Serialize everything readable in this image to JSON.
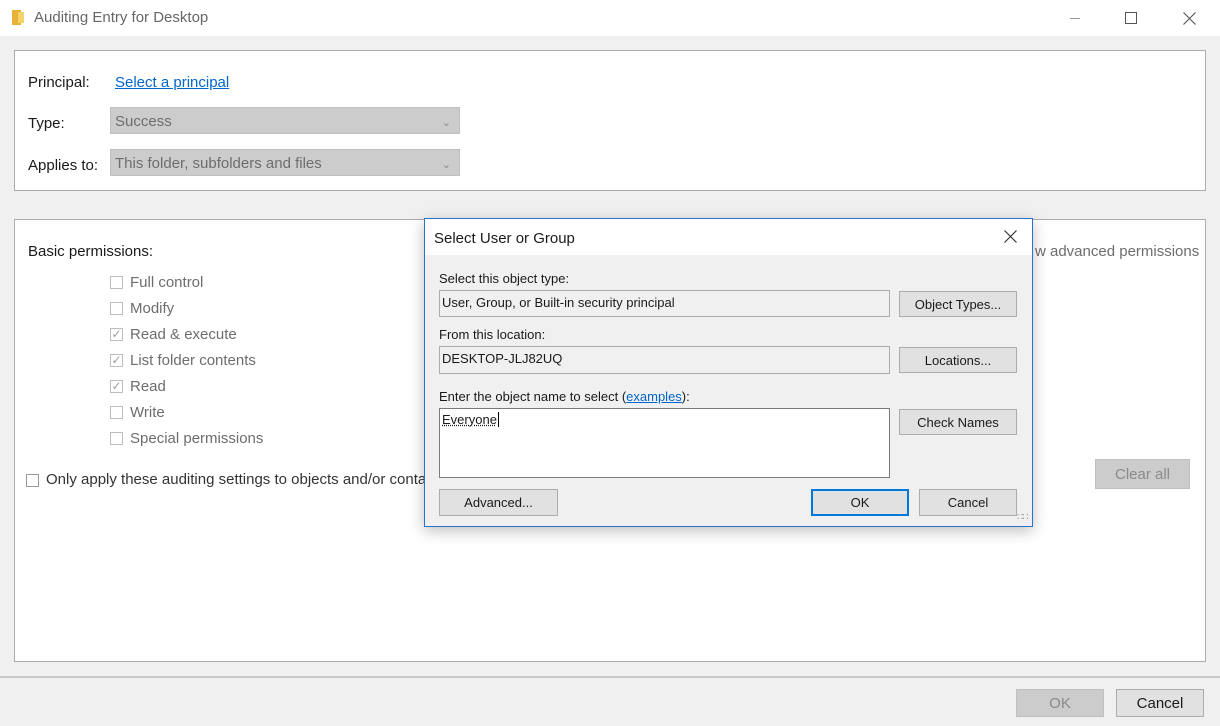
{
  "window": {
    "title": "Auditing Entry for Desktop",
    "icon": "folder-icon"
  },
  "principal": {
    "label": "Principal:",
    "link": "Select a principal"
  },
  "type": {
    "label": "Type:",
    "value": "Success"
  },
  "applies_to": {
    "label": "Applies to:",
    "value": "This folder, subfolders and files"
  },
  "permissions": {
    "heading": "Basic permissions:",
    "show_advanced_link": "w advanced permissions",
    "items": [
      {
        "label": "Full control",
        "checked": false
      },
      {
        "label": "Modify",
        "checked": false
      },
      {
        "label": "Read & execute",
        "checked": true
      },
      {
        "label": "List folder contents",
        "checked": true
      },
      {
        "label": "Read",
        "checked": true
      },
      {
        "label": "Write",
        "checked": false
      },
      {
        "label": "Special permissions",
        "checked": false
      }
    ],
    "only_apply_label": "Only apply these auditing settings to objects and/or conta",
    "clear_all": "Clear all"
  },
  "footer": {
    "ok": "OK",
    "cancel": "Cancel"
  },
  "dialog": {
    "title": "Select User or Group",
    "object_type_label": "Select this object type:",
    "object_type_value": "User, Group, or Built-in security principal",
    "object_types_button": "Object Types...",
    "location_label": "From this location:",
    "location_value": "DESKTOP-JLJ82UQ",
    "locations_button": "Locations...",
    "enter_label_prefix": "Enter the object name to select (",
    "enter_label_link": "examples",
    "enter_label_suffix": "):",
    "object_name_value": "Everyone",
    "check_names_button": "Check Names",
    "advanced_button": "Advanced...",
    "ok_button": "OK",
    "cancel_button": "Cancel"
  },
  "colors": {
    "link": "#0066cc",
    "dialog_border": "#2b73c8",
    "default_button_border": "#0078d7"
  }
}
